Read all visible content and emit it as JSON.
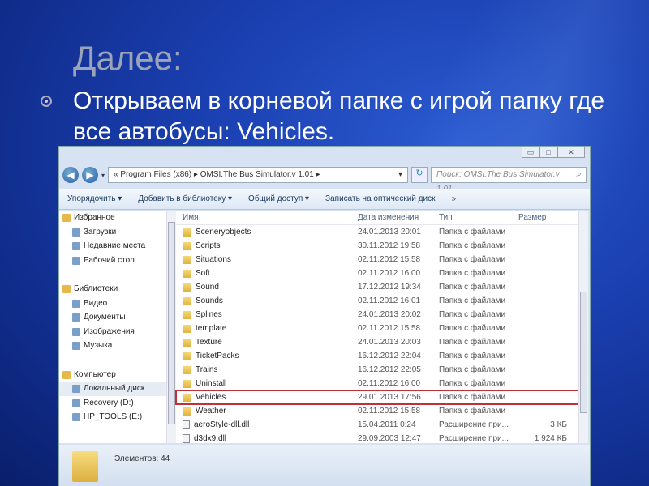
{
  "slide": {
    "title": "Далее:",
    "text": "Открываем в корневой папке с игрой папку где все автобусы: Vehicles."
  },
  "window": {
    "controls": [
      "minimize",
      "maximize",
      "close"
    ],
    "path": "« Program Files (x86) ▸ OMSI.The Bus Simulator.v 1.01 ▸",
    "search_placeholder": "Поиск: OMSI.The Bus Simulator.v 1.01",
    "toolbar": [
      "Упорядочить ▾",
      "Добавить в библиотеку ▾",
      "Общий доступ ▾",
      "Записать на оптический диск",
      "»"
    ],
    "nav": [
      {
        "label": "Избранное",
        "h": true
      },
      {
        "label": "Загрузки"
      },
      {
        "label": "Недавние места"
      },
      {
        "label": "Рабочий стол"
      },
      {
        "gap": true
      },
      {
        "label": "Библиотеки",
        "h": true
      },
      {
        "label": "Видео"
      },
      {
        "label": "Документы"
      },
      {
        "label": "Изображения"
      },
      {
        "label": "Музыка"
      },
      {
        "gap": true
      },
      {
        "label": "Компьютер",
        "h": true
      },
      {
        "label": "Локальный диск",
        "sel": true
      },
      {
        "label": "Recovery (D:)"
      },
      {
        "label": "HP_TOOLS (E:)"
      }
    ],
    "columns": [
      "Имя",
      "Дата изменения",
      "Тип",
      "Размер"
    ],
    "rows": [
      [
        "Sceneryobjects",
        "24.01.2013 20:01",
        "Папка с файлами",
        ""
      ],
      [
        "Scripts",
        "30.11.2012 19:58",
        "Папка с файлами",
        ""
      ],
      [
        "Situations",
        "02.11.2012 15:58",
        "Папка с файлами",
        ""
      ],
      [
        "Soft",
        "02.11.2012 16:00",
        "Папка с файлами",
        ""
      ],
      [
        "Sound",
        "17.12.2012 19:34",
        "Папка с файлами",
        ""
      ],
      [
        "Sounds",
        "02.11.2012 16:01",
        "Папка с файлами",
        ""
      ],
      [
        "Splines",
        "24.01.2013 20:02",
        "Папка с файлами",
        ""
      ],
      [
        "template",
        "02.11.2012 15:58",
        "Папка с файлами",
        ""
      ],
      [
        "Texture",
        "24.01.2013 20:03",
        "Папка с файлами",
        ""
      ],
      [
        "TicketPacks",
        "16.12.2012 22:04",
        "Папка с файлами",
        ""
      ],
      [
        "Trains",
        "16.12.2012 22:05",
        "Папка с файлами",
        ""
      ],
      [
        "Uninstall",
        "02.11.2012 16:00",
        "Папка с файлами",
        ""
      ],
      [
        "Vehicles",
        "29.01.2013 17:56",
        "Папка с файлами",
        ""
      ],
      [
        "Weather",
        "02.11.2012 15:58",
        "Папка с файлами",
        ""
      ],
      [
        "aeroStyle-dll.dll",
        "15.04.2011 0:24",
        "Расширение при...",
        "3 КБ"
      ],
      [
        "d3dx9.dll",
        "29.09.2003 12:47",
        "Расширение при...",
        "1 924 КБ"
      ]
    ],
    "highlighted_row": "Vehicles",
    "highlight_color": "#c0303a",
    "status": "Элементов: 44"
  }
}
